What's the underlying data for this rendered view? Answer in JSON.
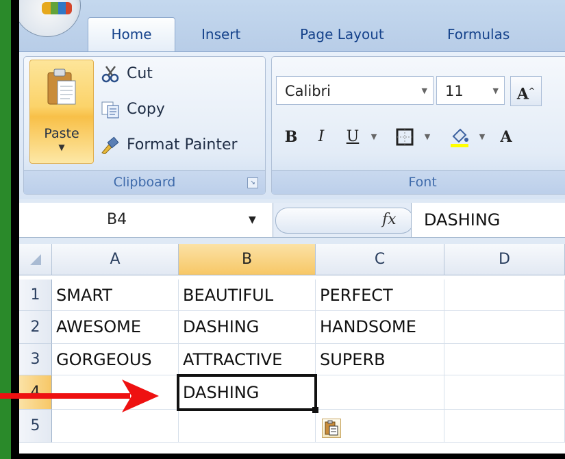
{
  "ribbon_tabs": [
    "Home",
    "Insert",
    "Page Layout",
    "Formulas"
  ],
  "active_tab": "Home",
  "clipboard": {
    "paste_label": "Paste",
    "cut_label": "Cut",
    "copy_label": "Copy",
    "format_painter_label": "Format Painter",
    "group_label": "Clipboard"
  },
  "font": {
    "font_name": "Calibri",
    "font_size": "11",
    "bold": "B",
    "italic": "I",
    "underline": "U",
    "group_label": "Font"
  },
  "formula_bar": {
    "name_box": "B4",
    "fx": "fx",
    "value": "DASHING"
  },
  "grid": {
    "columns": [
      "A",
      "B",
      "C",
      "D"
    ],
    "rows": [
      "1",
      "2",
      "3",
      "4",
      "5"
    ],
    "cells": [
      [
        "SMART",
        "BEAUTIFUL",
        "PERFECT",
        ""
      ],
      [
        "AWESOME",
        "DASHING",
        "HANDSOME",
        ""
      ],
      [
        "GORGEOUS",
        "ATTRACTIVE",
        "SUPERB",
        ""
      ],
      [
        "",
        "DASHING",
        "",
        ""
      ],
      [
        "",
        "",
        "",
        ""
      ]
    ],
    "active_cell": "B4"
  },
  "colors": {
    "frame_green": "#2a8a2a",
    "annotation_arrow": "#ee1111",
    "tab_text": "#15428b",
    "selected_header": "#f7c766"
  }
}
